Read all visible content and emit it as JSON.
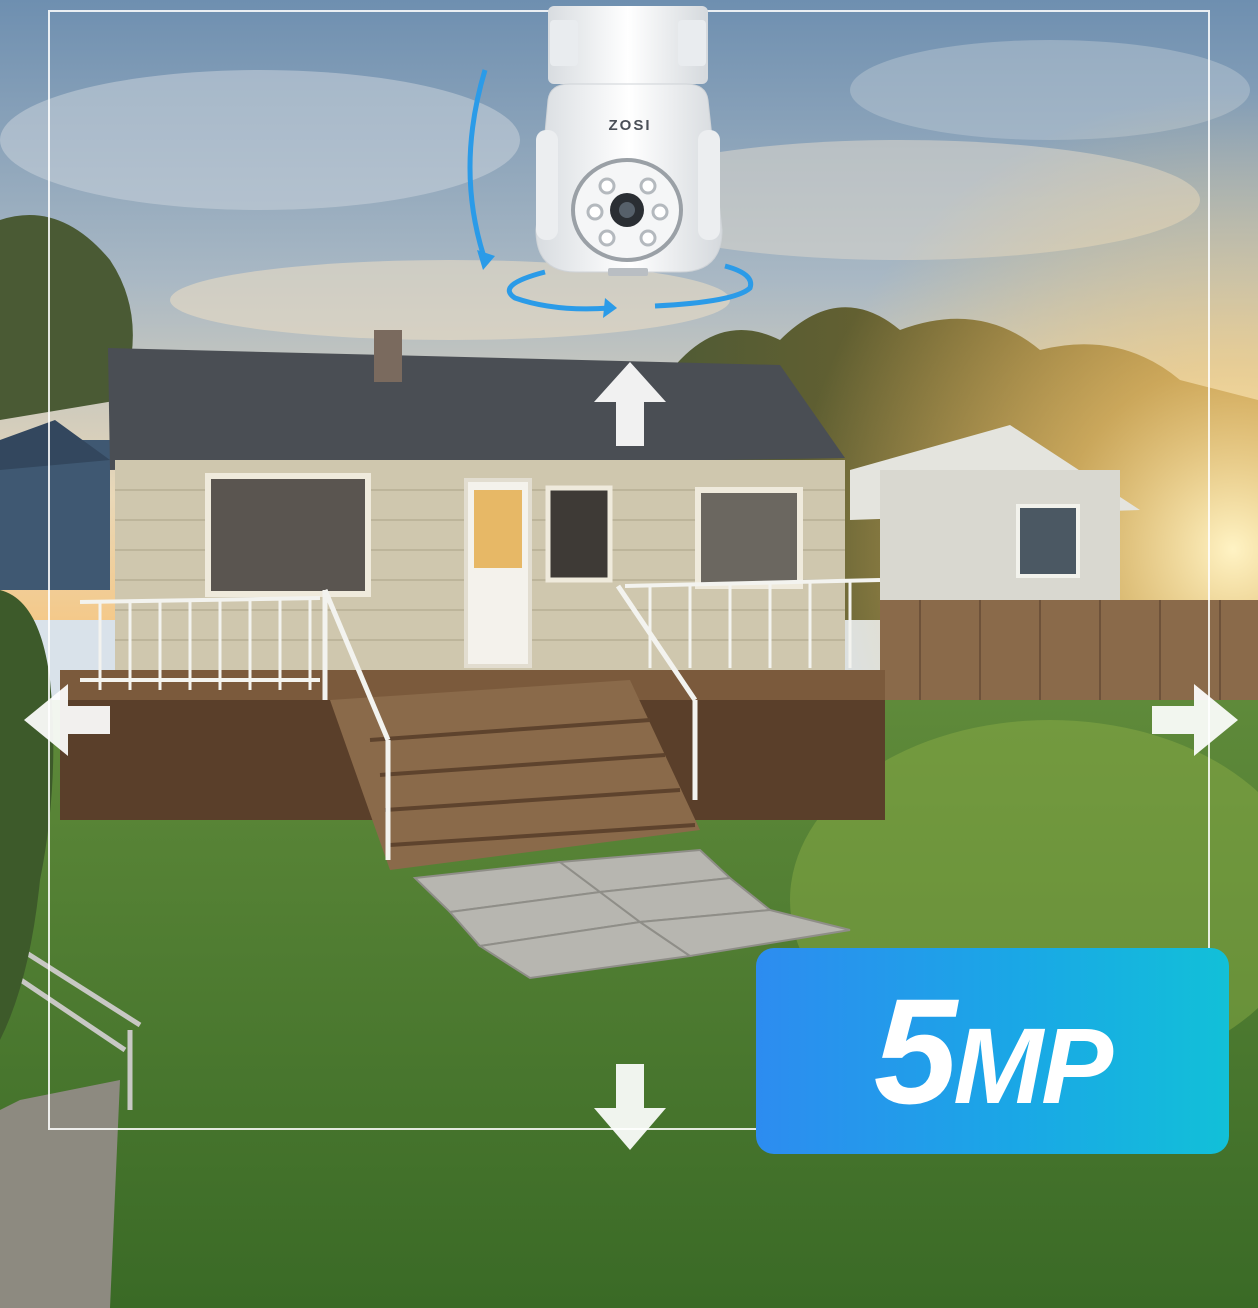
{
  "camera": {
    "brand": "ZOSI"
  },
  "badge": {
    "number": "5",
    "unit": "MP"
  },
  "colors": {
    "badge_start": "#2d8cf0",
    "badge_end": "#12c0d8",
    "rotation_arrow": "#2b9be8",
    "frame": "#ffffff"
  },
  "icons": [
    "pan-tilt-arrow-icon",
    "arrow-up-icon",
    "arrow-down-icon",
    "arrow-left-icon",
    "arrow-right-icon"
  ]
}
